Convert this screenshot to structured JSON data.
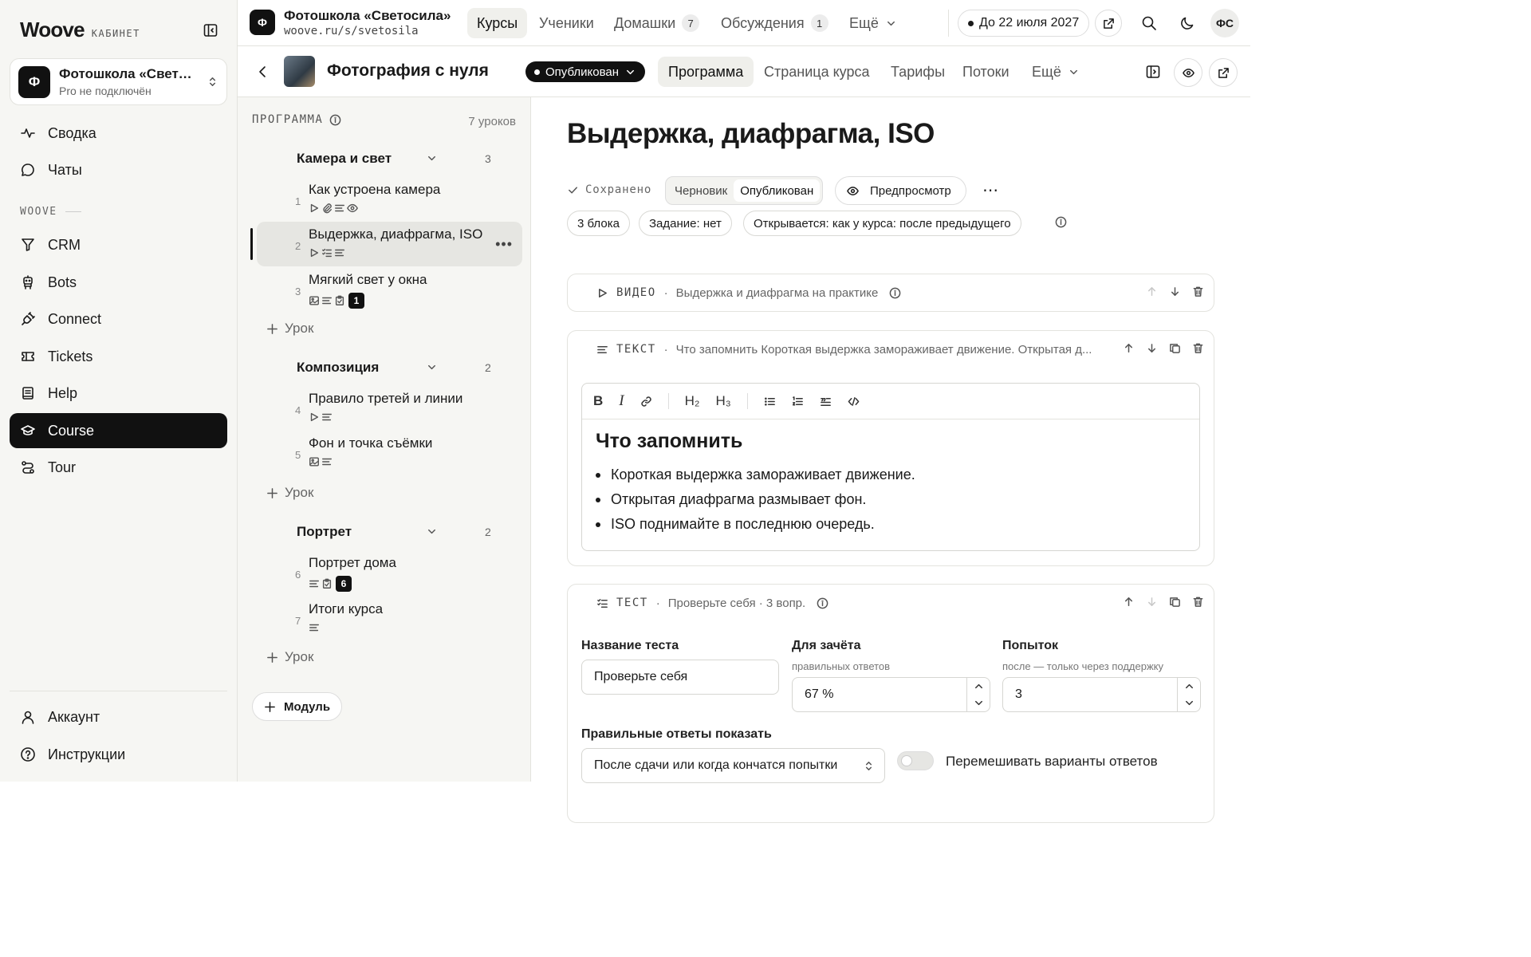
{
  "sidebar": {
    "logo": "Woove",
    "logo_sub": "КАБИНЕТ",
    "school": {
      "initial": "Ф",
      "name": "Фотошкола «Светосила»",
      "plan": "Pro не подключён"
    },
    "items_top": [
      {
        "label": "Сводка",
        "icon": "activity-icon"
      },
      {
        "label": "Чаты",
        "icon": "chat-icon"
      }
    ],
    "section_label": "WOOVE",
    "items": [
      {
        "label": "CRM",
        "icon": "filter-icon"
      },
      {
        "label": "Bots",
        "icon": "bot-icon"
      },
      {
        "label": "Connect",
        "icon": "plug-icon"
      },
      {
        "label": "Tickets",
        "icon": "ticket-icon"
      },
      {
        "label": "Help",
        "icon": "book-icon"
      },
      {
        "label": "Course",
        "icon": "graduation-cap-icon",
        "active": true
      },
      {
        "label": "Tour",
        "icon": "route-icon"
      }
    ],
    "items_bottom": [
      {
        "label": "Аккаунт",
        "icon": "user-icon"
      },
      {
        "label": "Инструкции",
        "icon": "help-circle-icon"
      }
    ]
  },
  "topbar": {
    "school_initial": "Ф",
    "school": "Фотошкола «Светосила»",
    "url": "woove.ru/s/svetosila",
    "tabs": [
      {
        "label": "Курсы",
        "active": true
      },
      {
        "label": "Ученики"
      },
      {
        "label": "Домашки",
        "count": "7"
      },
      {
        "label": "Обсуждения",
        "count": "1"
      },
      {
        "label": "Ещё"
      }
    ],
    "subscription": "До 22 июля 2027",
    "avatar": "ФС"
  },
  "course": {
    "title": "Фотография с нуля",
    "status": "Опубликован",
    "tabs": [
      "Программа",
      "Страница курса",
      "Тарифы",
      "Потоки",
      "Ещё"
    ],
    "active_tab": "Программа"
  },
  "program": {
    "heading": "ПРОГРАММА",
    "lessons_count": "7 уроков",
    "add_lesson": "Урок",
    "add_module": "Модуль",
    "modules": [
      {
        "title": "Камера и свет",
        "count": "3"
      },
      {
        "title": "Композиция",
        "count": "2"
      },
      {
        "title": "Портрет",
        "count": "2"
      }
    ],
    "lessons": [
      {
        "num": "1",
        "title": "Как устроена камера",
        "icons": [
          "play-icon",
          "attachment-icon",
          "text-icon",
          "eye-icon"
        ]
      },
      {
        "num": "2",
        "title": "Выдержка, диафрагма, ISO",
        "icons": [
          "play-icon",
          "checklist-icon",
          "text-icon"
        ],
        "active": true
      },
      {
        "num": "3",
        "title": "Мягкий свет у окна",
        "icons": [
          "image-icon",
          "text-icon",
          "clipboard-icon"
        ],
        "badge": "1"
      },
      {
        "num": "4",
        "title": "Правило третей и линии",
        "icons": [
          "play-icon",
          "text-icon"
        ]
      },
      {
        "num": "5",
        "title": "Фон и точка съёмки",
        "icons": [
          "image-icon",
          "text-icon"
        ]
      },
      {
        "num": "6",
        "title": "Портрет дома",
        "icons": [
          "text-icon",
          "clipboard-icon"
        ],
        "badge": "6"
      },
      {
        "num": "7",
        "title": "Итоги курса",
        "icons": [
          "text-icon"
        ]
      }
    ]
  },
  "lesson": {
    "title": "Выдержка, диафрагма, ISO",
    "saved": "Сохранено",
    "mode_draft": "Черновик",
    "mode_published": "Опубликован",
    "preview": "Предпросмотр",
    "chips": [
      "3 блока",
      "Задание: нет",
      "Открывается: как у курса: после предыдущего"
    ],
    "blocks": {
      "video": {
        "kind": "ВИДЕО",
        "desc": "Выдержка и диафрагма на практике"
      },
      "text": {
        "kind": "ТЕКСТ",
        "desc": "Что запомнить Короткая выдержка замораживает движение. Открытая д...",
        "toolbar": [
          "B",
          "I",
          "link",
          "H₂",
          "H₃",
          "bullet-list",
          "ordered-list",
          "quote",
          "code"
        ],
        "heading": "Что запомнить",
        "bullets": [
          "Короткая выдержка замораживает движение.",
          "Открытая диафрагма размывает фон.",
          "ISO поднимайте в последнюю очередь."
        ]
      },
      "test": {
        "kind": "ТЕСТ",
        "desc": "Проверьте себя · 3 вопр.",
        "name_label": "Название теста",
        "name_value": "Проверьте себя",
        "pass_label": "Для зачёта",
        "pass_hint": "правильных ответов",
        "pass_value": "67 %",
        "attempts_label": "Попыток",
        "attempts_hint": "после — только через поддержку",
        "attempts_value": "3",
        "show_label": "Правильные ответы показать",
        "show_value": "После сдачи или когда кончатся попытки",
        "shuffle_label": "Перемешивать варианты ответов",
        "shuffle_on": false
      }
    }
  }
}
